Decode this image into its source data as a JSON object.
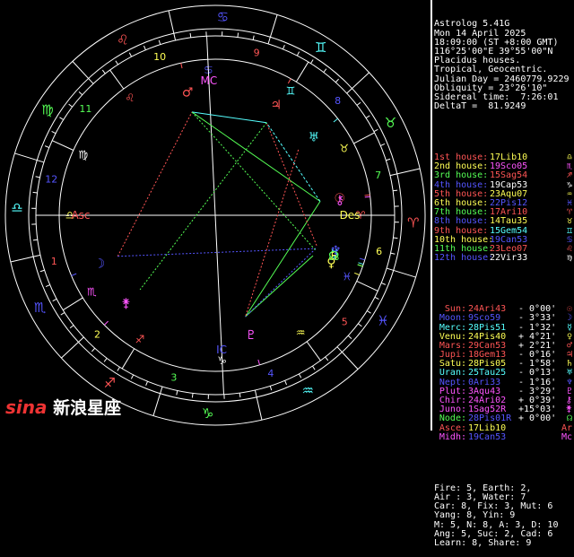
{
  "header": [
    "Astrolog 5.41G",
    "Mon 14 April 2025",
    "18:09:00 (ST +8:00 GMT)",
    "116°25'00\"E 39°55'00\"N",
    "Placidus houses.",
    "Tropical, Geocentric.",
    "Julian Day = 2460779.9229",
    "Obliquity = 23°26'10\"",
    "Sidereal time:  7:26:01",
    "DeltaT =  81.9249"
  ],
  "houses": [
    {
      "label": "1st house:",
      "value": "17Lib10",
      "color": "#ff5555",
      "vcolor": "#ffff55",
      "glyph": "♎"
    },
    {
      "label": "2nd house:",
      "value": "19Sco05",
      "color": "#ffff55",
      "vcolor": "#ff55ff",
      "glyph": "♏"
    },
    {
      "label": "3rd house:",
      "value": "15Sag54",
      "color": "#55ff55",
      "vcolor": "#ff5555",
      "glyph": "♐"
    },
    {
      "label": "4th house:",
      "value": "19Cap53",
      "color": "#5555ff",
      "vcolor": "#ffffff",
      "glyph": "♑"
    },
    {
      "label": "5th house:",
      "value": "23Aqu07",
      "color": "#ff5555",
      "vcolor": "#ffff55",
      "glyph": "♒"
    },
    {
      "label": "6th house:",
      "value": "22Pis12",
      "color": "#ffff55",
      "vcolor": "#5555ff",
      "glyph": "♓"
    },
    {
      "label": "7th house:",
      "value": "17Ari10",
      "color": "#55ff55",
      "vcolor": "#ff5555",
      "glyph": "♈"
    },
    {
      "label": "8th house:",
      "value": "14Tau35",
      "color": "#5555ff",
      "vcolor": "#ffff55",
      "glyph": "♉"
    },
    {
      "label": "9th house:",
      "value": "15Gem54",
      "color": "#ff5555",
      "vcolor": "#55ffff",
      "glyph": "♊"
    },
    {
      "label": "10th house:",
      "value": "19Can53",
      "color": "#ffff55",
      "vcolor": "#5555ff",
      "glyph": "♋"
    },
    {
      "label": "11th house:",
      "value": "23Leo07",
      "color": "#55ff55",
      "vcolor": "#ff5555",
      "glyph": "♌"
    },
    {
      "label": "12th house:",
      "value": "22Vir33",
      "color": "#5555ff",
      "vcolor": "#ffffff",
      "glyph": "♍"
    }
  ],
  "planets": [
    {
      "name": "Sun:",
      "pos": "24Ari43",
      "lat": "- 0°00'",
      "color": "#ff5555",
      "vcolor": "#ff5555",
      "glyph": "☉"
    },
    {
      "name": "Moon:",
      "pos": "9Sco59",
      "lat": "- 3°33'",
      "color": "#5555ff",
      "vcolor": "#5555ff",
      "glyph": "☽"
    },
    {
      "name": "Merc:",
      "pos": "28Pis51",
      "lat": "- 1°32'",
      "color": "#55ffff",
      "vcolor": "#55ffff",
      "glyph": "☿"
    },
    {
      "name": "Venu:",
      "pos": "24Pis40",
      "lat": "+ 4°21'",
      "color": "#ffff55",
      "vcolor": "#ffff55",
      "glyph": "♀"
    },
    {
      "name": "Mars:",
      "pos": "29Can53",
      "lat": "+ 2°21'",
      "color": "#ff5555",
      "vcolor": "#ff5555",
      "glyph": "♂"
    },
    {
      "name": "Jupi:",
      "pos": "18Gem13",
      "lat": "- 0°16'",
      "color": "#ff5555",
      "vcolor": "#ff5555",
      "glyph": "♃"
    },
    {
      "name": "Satu:",
      "pos": "28Pis05",
      "lat": "- 1°58'",
      "color": "#ffff55",
      "vcolor": "#ffff55",
      "glyph": "♄"
    },
    {
      "name": "Uran:",
      "pos": "25Tau25",
      "lat": "- 0°13'",
      "color": "#55ffff",
      "vcolor": "#55ffff",
      "glyph": "♅"
    },
    {
      "name": "Nept:",
      "pos": "0Ari33",
      "lat": "- 1°16'",
      "color": "#5555ff",
      "vcolor": "#5555ff",
      "glyph": "♆"
    },
    {
      "name": "Plut:",
      "pos": "3Aqu43",
      "lat": "- 3°29'",
      "color": "#ff55ff",
      "vcolor": "#ff55ff",
      "glyph": "♇"
    },
    {
      "name": "Chir:",
      "pos": "24Ari02",
      "lat": "+ 0°39'",
      "color": "#ff55ff",
      "vcolor": "#ff55ff",
      "glyph": "⚷"
    },
    {
      "name": "Juno:",
      "pos": "1Sag52R",
      "lat": "+15°03'",
      "color": "#ff55ff",
      "vcolor": "#ff55ff",
      "glyph": "⚵"
    },
    {
      "name": "Node:",
      "pos": "28Pis01R",
      "lat": "+ 0°00'",
      "color": "#55ff55",
      "vcolor": "#5555ff",
      "glyph": "☊"
    },
    {
      "name": "Asce:",
      "pos": "17Lib10",
      "lat": "",
      "color": "#ff5555",
      "vcolor": "#ffff55",
      "glyph": "Ar"
    },
    {
      "name": "Midh:",
      "pos": "19Can53",
      "lat": "",
      "color": "#ff55ff",
      "vcolor": "#5555ff",
      "glyph": "Mc"
    }
  ],
  "summary": [
    "Fire: 5, Earth: 2,",
    "Air : 3, Water: 7",
    "Car: 8, Fix: 3, Mut: 6",
    "Yang: 8, Yin: 9",
    "M: 5, N: 8, A: 3, D: 10",
    "Ang: 5, Suc: 2, Cad: 6",
    "Learn: 8, Share: 9"
  ],
  "watermark": {
    "brand": "sina",
    "text": "新浪星座"
  },
  "chart_labels": {
    "asc": "Asc",
    "des": "Des",
    "mc": "MC",
    "ic": "IC",
    "house_numbers": [
      "1",
      "2",
      "3",
      "4",
      "5",
      "6",
      "7",
      "8",
      "9",
      "10",
      "11",
      "12"
    ]
  }
}
